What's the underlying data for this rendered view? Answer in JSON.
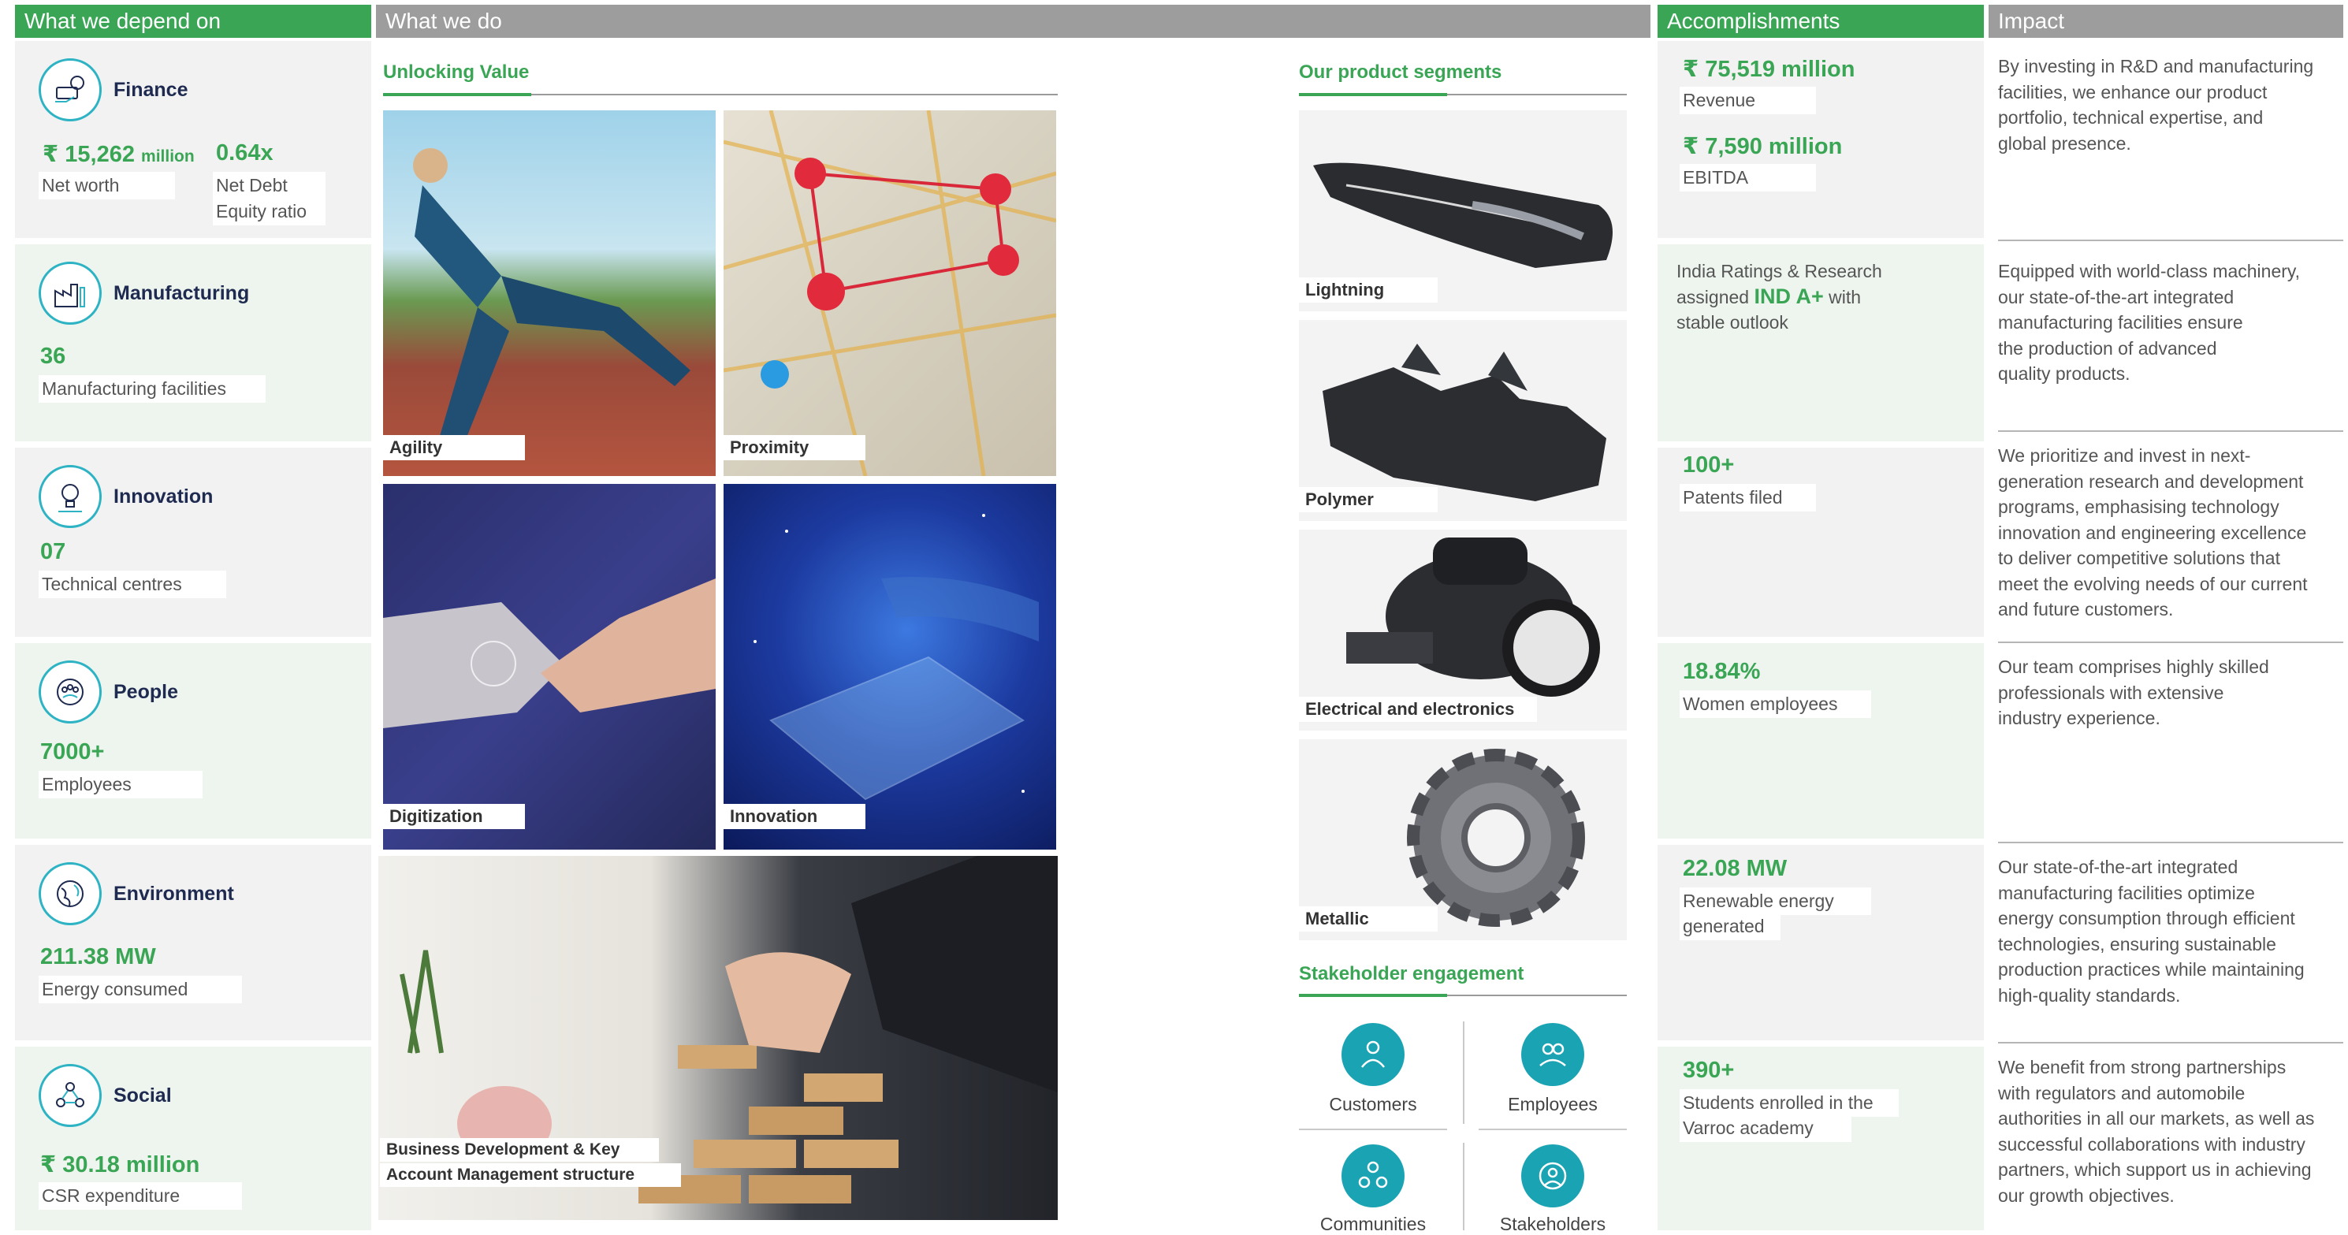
{
  "headers": {
    "depend": "What we depend on",
    "do": "What we do",
    "accomplishments": "Accomplishments",
    "impact": "Impact"
  },
  "capitals": {
    "finance": {
      "title": "Finance",
      "rupee": "₹",
      "value1": "15,262",
      "value1_unit": "million",
      "label1": "Net worth",
      "value2": "0.64x",
      "label2_line1": "Net Debt",
      "label2_line2": "Equity ratio"
    },
    "manufacturing": {
      "title": "Manufacturing",
      "value": "36",
      "label": "Manufacturing facilities"
    },
    "innovation": {
      "title": "Innovation",
      "value": "07",
      "label": "Technical centres"
    },
    "people": {
      "title": "People",
      "value": "7000+",
      "label": "Employees"
    },
    "environment": {
      "title": "Environment",
      "value": "211.38 MW",
      "label": "Energy consumed"
    },
    "social": {
      "title": "Social",
      "rupee": "₹",
      "value": "30.18 million",
      "label": "CSR expenditure"
    }
  },
  "unlocking": {
    "title": "Unlocking Value",
    "photos": [
      "Agility",
      "Proximity",
      "Digitization",
      "Innovation"
    ],
    "bottom_line1": "Business Development & Key",
    "bottom_line2": "Account Management structure"
  },
  "segments": {
    "title": "Our product segments",
    "items": [
      "Lightning",
      "Polymer",
      "Electrical and electronics",
      "Metallic"
    ]
  },
  "stakeholders": {
    "title": "Stakeholder engagement",
    "items": [
      "Customers",
      "Employees",
      "Communities",
      "Stakeholders"
    ]
  },
  "accomplishments": {
    "revenue": {
      "rupee": "₹",
      "value": "75,519 million",
      "label": "Revenue"
    },
    "ebitda": {
      "rupee": "₹",
      "value": "7,590 million",
      "label": "EBITDA"
    },
    "rating": {
      "line1": "India Ratings & Research",
      "line2_pre": "assigned",
      "line2_bold": "IND A+",
      "line2_post": "with",
      "line3": "stable outlook"
    },
    "patents": {
      "value": "100+",
      "label": "Patents filed"
    },
    "women": {
      "value": "18.84%",
      "label": "Women employees"
    },
    "renewable": {
      "value": "22.08 MW",
      "label_line1": "Renewable energy",
      "label_line2": "generated"
    },
    "students": {
      "value": "390+",
      "label_line1": "Students enrolled in the",
      "label_line2": "Varroc academy"
    }
  },
  "impact": [
    [
      "By investing in R&D and manufacturing",
      "facilities, we enhance our product",
      "portfolio, technical expertise, and",
      "global presence."
    ],
    [
      "Equipped with world-class machinery,",
      "our state-of-the-art integrated",
      "manufacturing facilities ensure",
      "the production of advanced",
      "quality products."
    ],
    [
      "We prioritize and invest in next-",
      "generation research and development",
      "programs, emphasising technology",
      "innovation and engineering excellence",
      "to deliver competitive solutions that",
      "meet the evolving needs of our current",
      "and future customers."
    ],
    [
      "Our team comprises highly skilled",
      "professionals with extensive",
      "industry experience."
    ],
    [
      "Our state-of-the-art integrated",
      "manufacturing facilities optimize",
      "energy consumption through efficient",
      "technologies, ensuring sustainable",
      "production practices while maintaining",
      "high-quality standards."
    ],
    [
      "We benefit from strong partnerships",
      "with regulators and automobile",
      "authorities in all our markets, as well as",
      "successful collaborations with industry",
      "partners, which support us in achieving",
      "our growth objectives."
    ]
  ]
}
